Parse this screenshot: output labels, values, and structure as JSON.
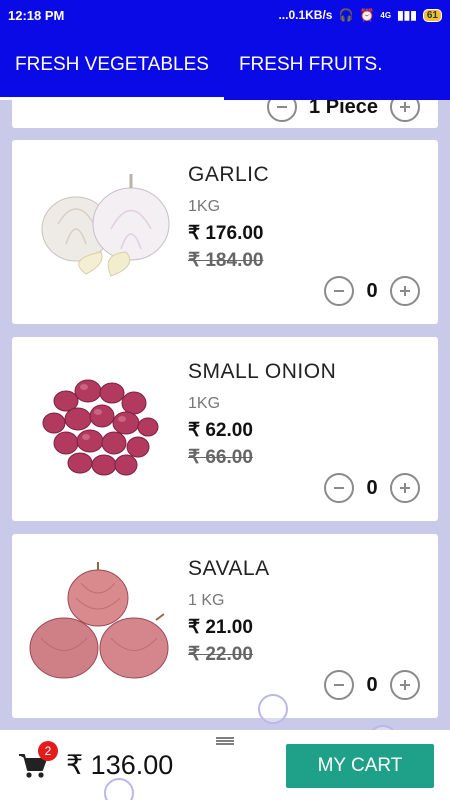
{
  "status": {
    "time": "12:18 PM",
    "network_speed": "...0.1KB/s",
    "network_type": "4G",
    "battery": "61"
  },
  "tabs": [
    {
      "label": "FRESH VEGETABLES",
      "active": true
    },
    {
      "label": "FRESH FRUITS.",
      "active": false
    }
  ],
  "partial_item": {
    "count": "1 Piece"
  },
  "products": [
    {
      "name": "GARLIC",
      "quantity": "1KG",
      "price": "₹ 176.00",
      "mrp": "₹ 184.00",
      "count": "0",
      "icon": "garlic-image"
    },
    {
      "name": "SMALL ONION",
      "quantity": "1KG",
      "price": "₹ 62.00",
      "mrp": "₹ 66.00",
      "count": "0",
      "icon": "shallots-image"
    },
    {
      "name": "SAVALA",
      "quantity": "1 KG",
      "price": "₹ 21.00",
      "mrp": "₹ 22.00",
      "count": "0",
      "icon": "onion-image"
    }
  ],
  "cart": {
    "badge_count": "2",
    "total": "₹ 136.00",
    "button_label": "MY CART"
  },
  "colors": {
    "app_bar": "#0a0ae6",
    "background": "#c9c9ea",
    "cart_button": "#1fa089",
    "badge": "#e41b1b"
  }
}
